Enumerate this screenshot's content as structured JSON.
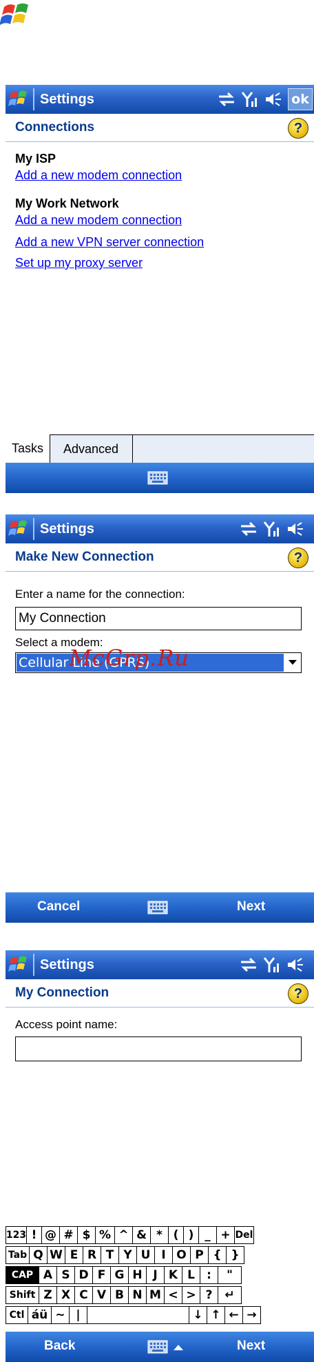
{
  "screen1": {
    "title": "Settings",
    "ok_label": "ok",
    "header": "Connections",
    "groups": [
      {
        "name": "My ISP",
        "links": [
          "Add a new modem connection"
        ]
      },
      {
        "name": "My Work Network",
        "links": [
          "Add a new modem connection",
          "Add a new VPN server connection",
          "Set up my proxy server"
        ]
      }
    ],
    "tabs": [
      "Tasks",
      "Advanced"
    ]
  },
  "screen2": {
    "title": "Settings",
    "header": "Make New Connection",
    "name_label": "Enter a name for the connection:",
    "name_value": "My Connection",
    "modem_label": "Select a modem:",
    "modem_value": "Cellular Line (GPRS)",
    "left_softkey": "Cancel",
    "right_softkey": "Next"
  },
  "screen3": {
    "title": "Settings",
    "header": "My Connection",
    "apn_label": "Access point name:",
    "apn_value": "",
    "left_softkey": "Back",
    "right_softkey": "Next"
  },
  "watermark": "McGrp.Ru",
  "keyboard": {
    "rows": [
      [
        "123",
        "!",
        "@",
        "#",
        "$",
        "%",
        "^",
        "&",
        "*",
        "(",
        ")",
        "_",
        "+",
        "Del"
      ],
      [
        "Tab",
        "Q",
        "W",
        "E",
        "R",
        "T",
        "Y",
        "U",
        "I",
        "O",
        "P",
        "{",
        "}"
      ],
      [
        "CAP",
        "A",
        "S",
        "D",
        "F",
        "G",
        "H",
        "J",
        "K",
        "L",
        ":",
        "\""
      ],
      [
        "Shift",
        "Z",
        "X",
        "C",
        "V",
        "B",
        "N",
        "M",
        "<",
        ">",
        "?",
        "↵"
      ],
      [
        "Ctl",
        "áü",
        "~",
        "|",
        "",
        "↓",
        "↑",
        "←",
        "→"
      ]
    ]
  },
  "colors": {
    "titlebar": "#2a62c8",
    "header_text": "#0a3b8c",
    "link": "#0000ee",
    "selection": "#2f6bd6"
  }
}
